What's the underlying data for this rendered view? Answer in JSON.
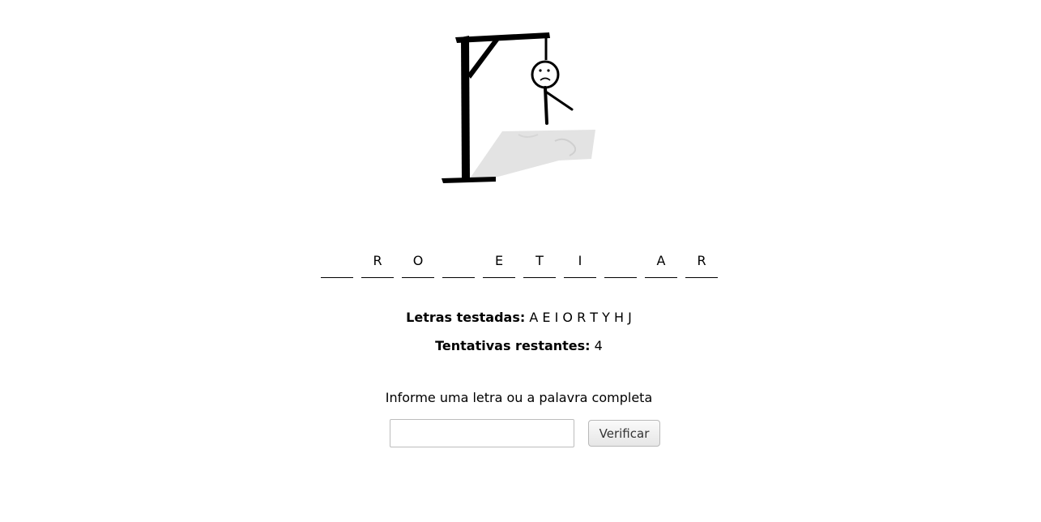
{
  "game": {
    "word_slots": [
      "",
      "R",
      "O",
      "",
      "E",
      "T",
      "I",
      "",
      "A",
      "R"
    ],
    "guessed_label": "Letras testadas:",
    "guessed_letters": "A E I O R T Y H J",
    "remaining_label": "Tentativas restantes:",
    "remaining_count": "4"
  },
  "form": {
    "prompt": "Informe uma letra ou a palavra completa",
    "input_value": "",
    "verify_label": "Verificar"
  },
  "illustration": {
    "icon": "hangman-gallows-icon",
    "figure_parts_shown": [
      "head",
      "body",
      "one-arm"
    ]
  }
}
